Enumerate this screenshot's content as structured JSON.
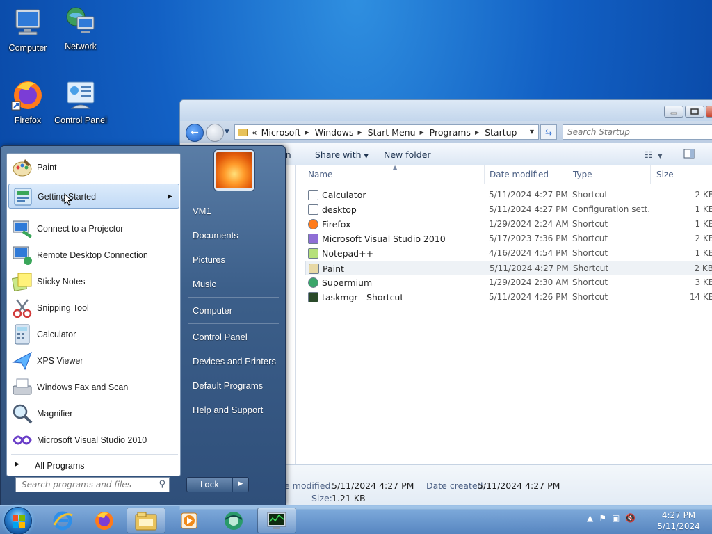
{
  "desktop": {
    "icons": [
      {
        "label": "Computer",
        "icon": "computer-icon"
      },
      {
        "label": "Network",
        "icon": "network-icon"
      },
      {
        "label": "Firefox",
        "icon": "firefox-icon"
      },
      {
        "label": "Control Panel",
        "icon": "control-panel-icon"
      }
    ]
  },
  "explorer": {
    "address": {
      "back_icon": "back-arrow-icon",
      "forward_icon": "forward-arrow-icon",
      "breadcrumb_lead": "«",
      "breadcrumb": [
        "Microsoft",
        "Windows",
        "Start Menu",
        "Programs",
        "Startup"
      ],
      "search_placeholder": "Search Startup"
    },
    "toolbar": {
      "open_partial": "en",
      "share_with": "Share with",
      "new_folder": "New folder"
    },
    "columns": {
      "name": "Name",
      "date": "Date modified",
      "type": "Type",
      "size": "Size"
    },
    "files": [
      {
        "name": "Calculator",
        "date": "5/11/2024 4:27 PM",
        "type": "Shortcut",
        "size": "2 KB"
      },
      {
        "name": "desktop",
        "date": "5/11/2024 4:27 PM",
        "type": "Configuration sett...",
        "size": "1 KB"
      },
      {
        "name": "Firefox",
        "date": "1/29/2024 2:24 AM",
        "type": "Shortcut",
        "size": "1 KB"
      },
      {
        "name": "Microsoft Visual Studio 2010",
        "date": "5/17/2023 7:36 PM",
        "type": "Shortcut",
        "size": "2 KB"
      },
      {
        "name": "Notepad++",
        "date": "4/16/2024 4:54 PM",
        "type": "Shortcut",
        "size": "1 KB"
      },
      {
        "name": "Paint",
        "date": "5/11/2024 4:27 PM",
        "type": "Shortcut",
        "size": "2 KB"
      },
      {
        "name": "Supermium",
        "date": "1/29/2024 2:30 AM",
        "type": "Shortcut",
        "size": "3 KB"
      },
      {
        "name": "taskmgr - Shortcut",
        "date": "5/11/2024 4:26 PM",
        "type": "Shortcut",
        "size": "14 KB"
      }
    ],
    "details": {
      "modified_label": "e modified:",
      "modified_value": "5/11/2024 4:27 PM",
      "created_label": "Date created:",
      "created_value": "5/11/2024 4:27 PM",
      "size_label": "Size:",
      "size_value": "1.21 KB"
    }
  },
  "start_menu": {
    "programs": [
      {
        "label": "Paint",
        "icon": "paint-icon"
      },
      {
        "label": "Getting Started",
        "icon": "getting-started-icon",
        "has_submenu": true
      },
      {
        "label": "Connect to a Projector",
        "icon": "projector-icon"
      },
      {
        "label": "Remote Desktop Connection",
        "icon": "remote-desktop-icon"
      },
      {
        "label": "Sticky Notes",
        "icon": "sticky-notes-icon"
      },
      {
        "label": "Snipping Tool",
        "icon": "snipping-tool-icon"
      },
      {
        "label": "Calculator",
        "icon": "calculator-icon"
      },
      {
        "label": "XPS Viewer",
        "icon": "xps-viewer-icon"
      },
      {
        "label": "Windows Fax and Scan",
        "icon": "fax-scan-icon"
      },
      {
        "label": "Magnifier",
        "icon": "magnifier-icon"
      },
      {
        "label": "Microsoft Visual Studio 2010",
        "icon": "visual-studio-icon"
      }
    ],
    "all_programs": "All Programs",
    "search_placeholder": "Search programs and files",
    "right_links": [
      "VM1",
      "Documents",
      "Pictures",
      "Music",
      "Computer",
      "Control Panel",
      "Devices and Printers",
      "Default Programs",
      "Help and Support"
    ],
    "lock_label": "Lock"
  },
  "taskbar": {
    "apps": [
      "internet-explorer-icon",
      "firefox-icon",
      "explorer-icon",
      "media-player-icon",
      "supermium-icon",
      "task-manager-icon"
    ],
    "clock_time": "4:27 PM",
    "clock_date": "5/11/2024"
  },
  "colors": {
    "accent": "#1260c4",
    "highlight": "#c1daf6"
  }
}
